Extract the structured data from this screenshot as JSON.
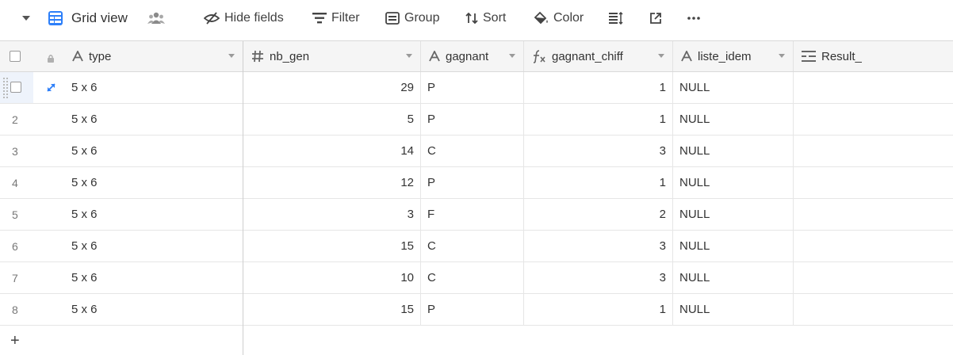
{
  "toolbar": {
    "view_name": "Grid view",
    "hide_fields": "Hide fields",
    "filter": "Filter",
    "group": "Group",
    "sort": "Sort",
    "color": "Color",
    "icons": [
      "caret-down",
      "grid-view",
      "people",
      "hide-fields",
      "filter",
      "group",
      "sort",
      "color-bucket",
      "row-height",
      "share-external",
      "more"
    ]
  },
  "columns": [
    {
      "name": "type",
      "field_type": "text"
    },
    {
      "name": "nb_gen",
      "field_type": "number"
    },
    {
      "name": "gagnant",
      "field_type": "text"
    },
    {
      "name": "gagnant_chiff",
      "field_type": "formula"
    },
    {
      "name": "liste_idem",
      "field_type": "text"
    },
    {
      "name": "Result_",
      "field_type": "long-text"
    }
  ],
  "rows": [
    {
      "num": "1",
      "type": "5 x 6",
      "nb_gen": "29",
      "gagnant": "P",
      "gagnant_chiff": "1",
      "liste_idem": "NULL",
      "result": ""
    },
    {
      "num": "2",
      "type": "5 x 6",
      "nb_gen": "5",
      "gagnant": "P",
      "gagnant_chiff": "1",
      "liste_idem": "NULL",
      "result": ""
    },
    {
      "num": "3",
      "type": "5 x 6",
      "nb_gen": "14",
      "gagnant": "C",
      "gagnant_chiff": "3",
      "liste_idem": "NULL",
      "result": ""
    },
    {
      "num": "4",
      "type": "5 x 6",
      "nb_gen": "12",
      "gagnant": "P",
      "gagnant_chiff": "1",
      "liste_idem": "NULL",
      "result": ""
    },
    {
      "num": "5",
      "type": "5 x 6",
      "nb_gen": "3",
      "gagnant": "F",
      "gagnant_chiff": "2",
      "liste_idem": "NULL",
      "result": ""
    },
    {
      "num": "6",
      "type": "5 x 6",
      "nb_gen": "15",
      "gagnant": "C",
      "gagnant_chiff": "3",
      "liste_idem": "NULL",
      "result": ""
    },
    {
      "num": "7",
      "type": "5 x 6",
      "nb_gen": "10",
      "gagnant": "C",
      "gagnant_chiff": "3",
      "liste_idem": "NULL",
      "result": ""
    },
    {
      "num": "8",
      "type": "5 x 6",
      "nb_gen": "15",
      "gagnant": "P",
      "gagnant_chiff": "1",
      "liste_idem": "NULL",
      "result": ""
    }
  ],
  "add_row_label": "+",
  "colors": {
    "accent": "#2d7ff9",
    "header_bg": "#f5f5f5",
    "border": "#e2e2e2"
  }
}
